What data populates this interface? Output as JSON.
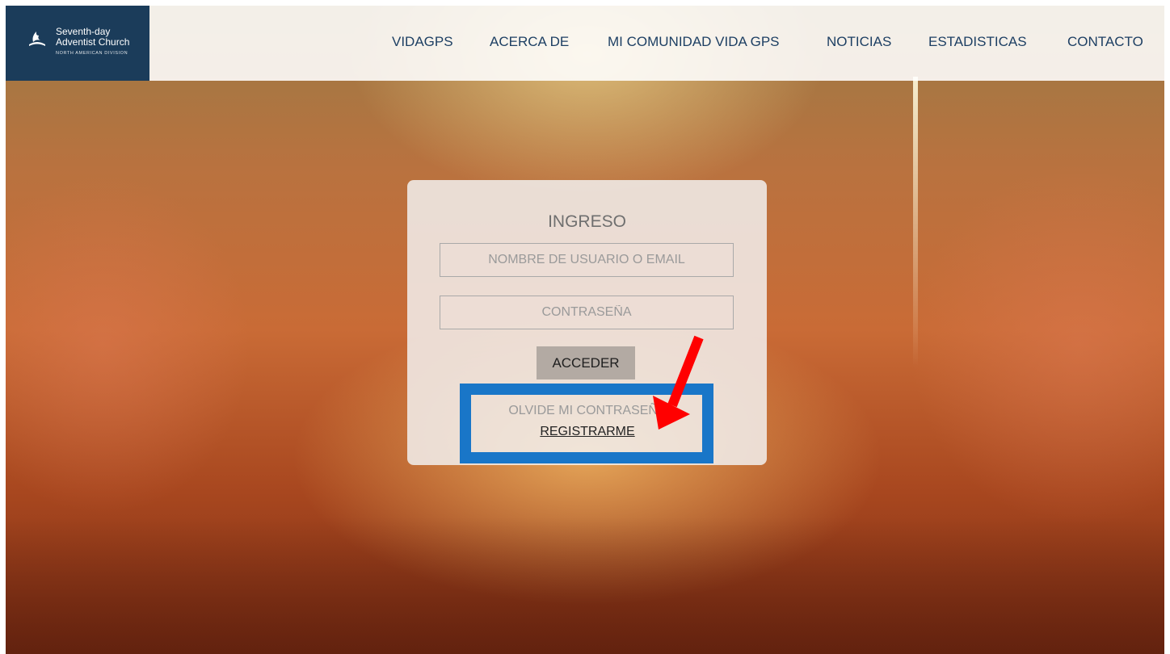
{
  "brand": {
    "line1": "Seventh-day",
    "line2": "Adventist Church",
    "line3": "NORTH AMERICAN DIVISION",
    "bg_color": "#1b3c5a"
  },
  "nav": {
    "items": [
      {
        "label": "VIDAGPS"
      },
      {
        "label": "ACERCA DE"
      },
      {
        "label": "MI COMUNIDAD VIDA GPS"
      },
      {
        "label": "NOTICIAS"
      },
      {
        "label": "ESTADISTICAS"
      },
      {
        "label": "CONTACTO"
      }
    ],
    "color": "#1d3f63"
  },
  "login": {
    "title": "INGRESO",
    "username_placeholder": "NOMBRE DE USUARIO O EMAIL",
    "password_placeholder": "CONTRASEÑA",
    "submit_label": "ACCEDER",
    "forgot_label": "OLVIDE MI CONTRASEÑA",
    "register_label": "REGISTRARME"
  },
  "annotation": {
    "highlight_color": "#1976c8",
    "arrow_color": "#ff0000",
    "arrow_icon": "red-arrow-icon"
  }
}
